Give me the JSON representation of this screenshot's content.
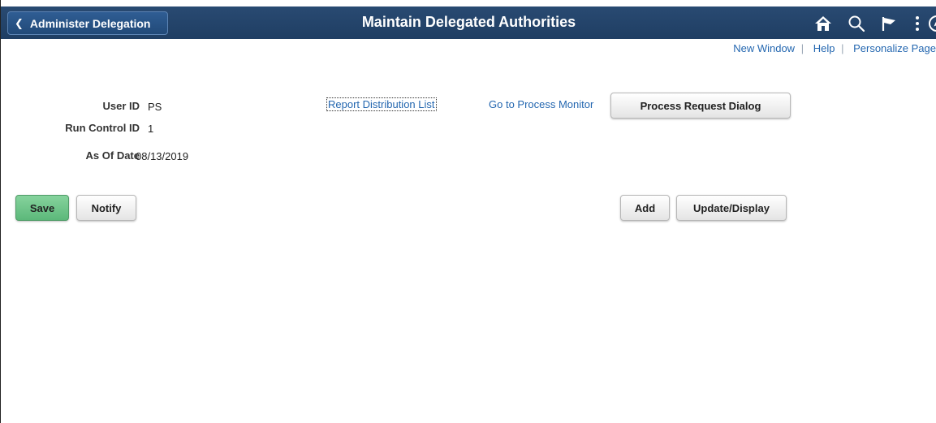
{
  "header": {
    "back_label": "Administer Delegation",
    "title": "Maintain Delegated Authorities",
    "icons": [
      "home-icon",
      "search-icon",
      "flag-icon",
      "kebab-menu-icon",
      "navbar-compass-icon"
    ]
  },
  "top_links": {
    "new_window": "New Window",
    "help": "Help",
    "personalize": "Personalize Page",
    "separator": "|"
  },
  "form": {
    "user_id_label": "User ID",
    "user_id_value": "PS",
    "run_control_label": "Run Control ID",
    "run_control_value": "1",
    "as_of_date_label": "As Of Date",
    "as_of_date_value": "08/13/2019"
  },
  "actions": {
    "report_distribution": "Report Distribution List",
    "process_monitor": "Go to Process Monitor",
    "process_request": "Process Request Dialog",
    "save": "Save",
    "notify": "Notify",
    "add": "Add",
    "update_display": "Update/Display"
  },
  "colors": {
    "banner": "#294a72",
    "link": "#2467b0",
    "save_button": "#5cb87a"
  }
}
